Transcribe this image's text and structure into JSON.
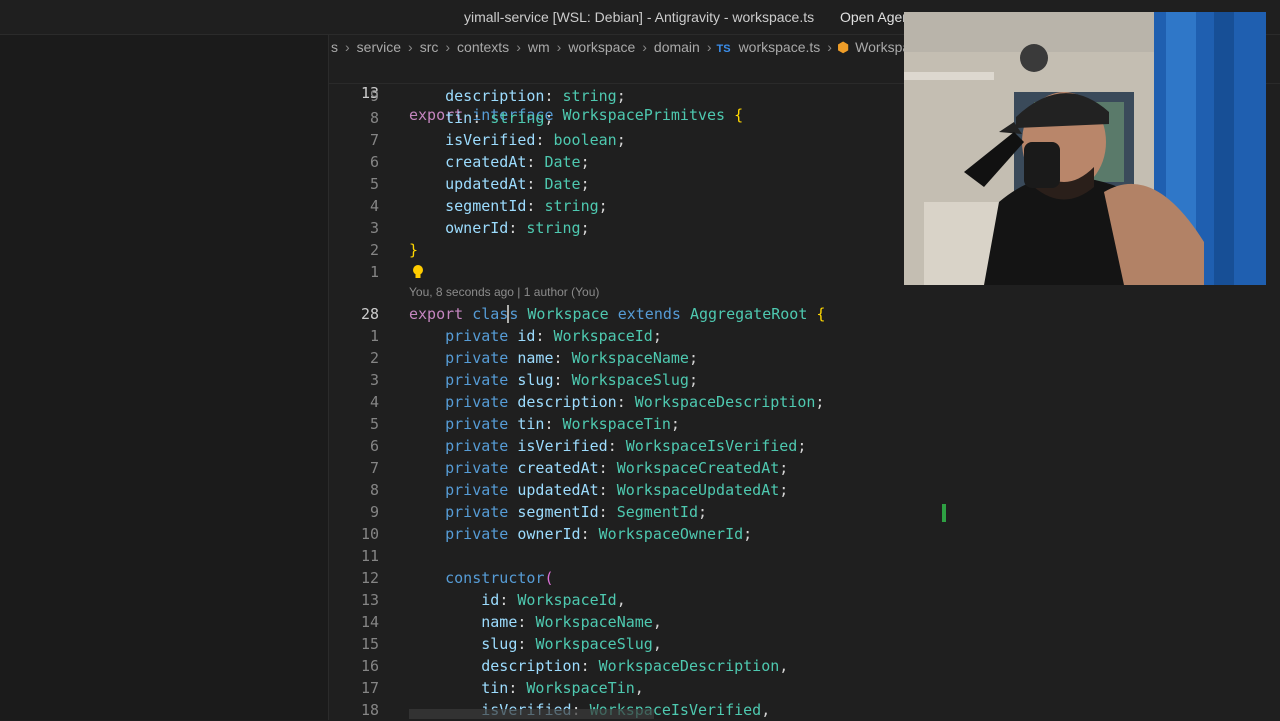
{
  "window": {
    "title": "yimall-service [WSL: Debian] - Antigravity - workspace.ts",
    "open_agent_label": "Open Agent Manager"
  },
  "breadcrumb": {
    "items": [
      "s",
      "service",
      "src",
      "contexts",
      "wm",
      "workspace",
      "domain"
    ],
    "file_badge": "TS",
    "file_name": "workspace.ts",
    "symbol": "Workspace"
  },
  "blame": "You, 8 seconds ago | 1 author (You)",
  "sticky": {
    "line_number": "13",
    "text": "export interface WorkspacePrimitves {"
  },
  "lines_top": [
    {
      "n": "9",
      "p": "description",
      "t": "string"
    },
    {
      "n": "8",
      "p": "tin",
      "t": "string"
    },
    {
      "n": "7",
      "p": "isVerified",
      "t": "boolean"
    },
    {
      "n": "6",
      "p": "createdAt",
      "t": "Date"
    },
    {
      "n": "5",
      "p": "updatedAt",
      "t": "Date"
    },
    {
      "n": "4",
      "p": "segmentId",
      "t": "string"
    },
    {
      "n": "3",
      "p": "ownerId",
      "t": "string"
    }
  ],
  "line_close": {
    "n": "2",
    "text": "}"
  },
  "line_empty": {
    "n": "1"
  },
  "class_line": {
    "n": "28",
    "kw1": "export",
    "kw2": "class",
    "name": "Workspace",
    "extends": "extends",
    "base": "AggregateRoot",
    "brace": "{"
  },
  "fields": [
    {
      "n": "1",
      "mod": "private",
      "p": "id",
      "t": "WorkspaceId"
    },
    {
      "n": "2",
      "mod": "private",
      "p": "name",
      "t": "WorkspaceName"
    },
    {
      "n": "3",
      "mod": "private",
      "p": "slug",
      "t": "WorkspaceSlug"
    },
    {
      "n": "4",
      "mod": "private",
      "p": "description",
      "t": "WorkspaceDescription"
    },
    {
      "n": "5",
      "mod": "private",
      "p": "tin",
      "t": "WorkspaceTin"
    },
    {
      "n": "6",
      "mod": "private",
      "p": "isVerified",
      "t": "WorkspaceIsVerified"
    },
    {
      "n": "7",
      "mod": "private",
      "p": "createdAt",
      "t": "WorkspaceCreatedAt"
    },
    {
      "n": "8",
      "mod": "private",
      "p": "updatedAt",
      "t": "WorkspaceUpdatedAt"
    },
    {
      "n": "9",
      "mod": "private",
      "p": "segmentId",
      "t": "SegmentId"
    },
    {
      "n": "10",
      "mod": "private",
      "p": "ownerId",
      "t": "WorkspaceOwnerId"
    }
  ],
  "blank_line": {
    "n": "11"
  },
  "ctor_line": {
    "n": "12",
    "kw": "constructor",
    "paren": "("
  },
  "params": [
    {
      "n": "13",
      "p": "id",
      "t": "WorkspaceId"
    },
    {
      "n": "14",
      "p": "name",
      "t": "WorkspaceName"
    },
    {
      "n": "15",
      "p": "slug",
      "t": "WorkspaceSlug"
    },
    {
      "n": "16",
      "p": "description",
      "t": "WorkspaceDescription"
    },
    {
      "n": "17",
      "p": "tin",
      "t": "WorkspaceTin"
    },
    {
      "n": "18",
      "p": "isVerified",
      "t": "WorkspaceIsVerified"
    }
  ],
  "colors": {
    "keyword": "#569cd6",
    "type": "#4ec9b0",
    "property": "#9cdcfe",
    "bracket": "#ffd700",
    "git_added": "#2ea043"
  }
}
